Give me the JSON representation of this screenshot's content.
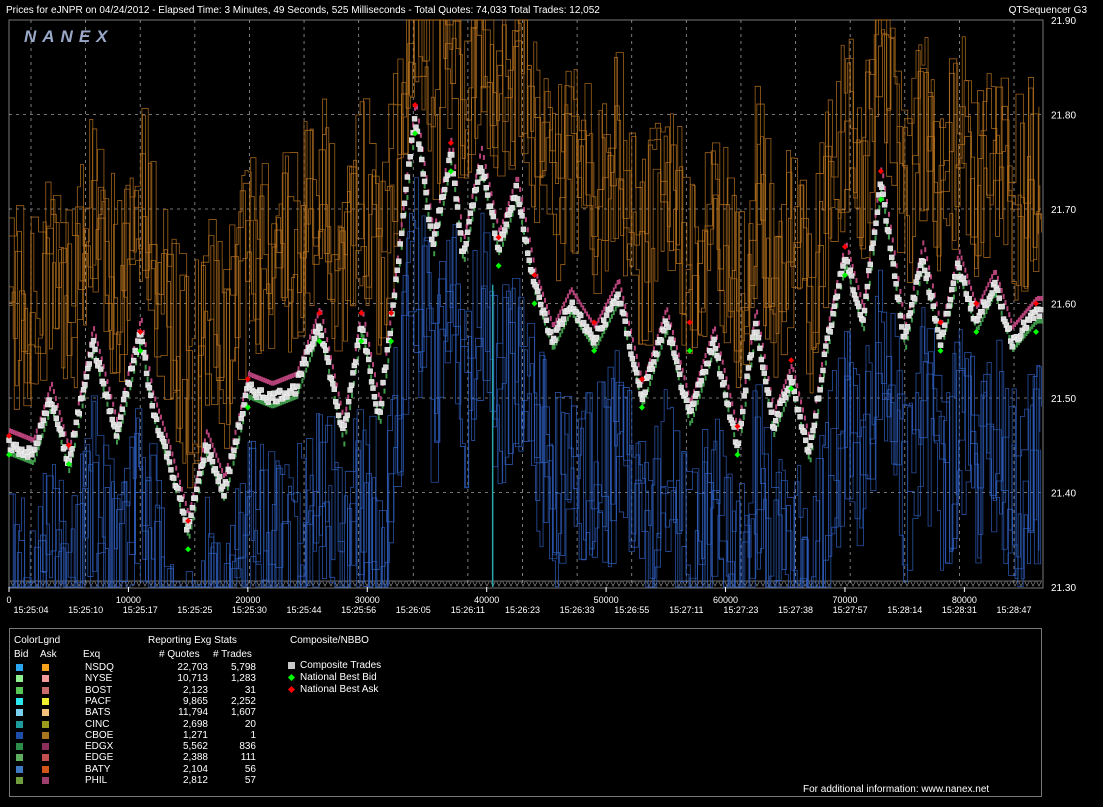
{
  "header": {
    "title": "Prices for  eJNPR  on  04/24/2012  -  Elapsed Time: 3 Minutes, 49 Seconds, 525 Milliseconds  -  Total Quotes: 74,033  Total Trades: 12,052",
    "app_name": "QTSequencer G3",
    "watermark": "NANEX"
  },
  "chart_data": {
    "type": "line",
    "title": "",
    "xlabel": "",
    "ylabel": "",
    "xlim": [
      0,
      86500
    ],
    "ylim": [
      21.3,
      21.9
    ],
    "grid": true,
    "y_ticks": [
      "21.90",
      "21.80",
      "21.70",
      "21.60",
      "21.50",
      "21.40",
      "21.30"
    ],
    "x_ticks": [
      "0",
      "10000",
      "20000",
      "30000",
      "40000",
      "50000",
      "60000",
      "70000",
      "80000"
    ],
    "time_labels": [
      "15:25:04",
      "15:25:10",
      "15:25:17",
      "15:25:25",
      "15:25:30",
      "15:25:44",
      "15:25:56",
      "15:26:05",
      "15:26:11",
      "15:26:23",
      "15:26:33",
      "15:26:55",
      "15:27:11",
      "15:27:23",
      "15:27:38",
      "15:27:57",
      "15:28:14",
      "15:28:31",
      "15:28:47"
    ],
    "series": [
      {
        "name": "Composite Trades",
        "x": [
          0,
          2000,
          3500,
          5000,
          7000,
          9000,
          11000,
          12000,
          13500,
          15000,
          16500,
          18000,
          20000,
          22000,
          24000,
          26000,
          28000,
          29500,
          31000,
          32000,
          34000,
          35500,
          37000,
          38000,
          39500,
          41000,
          42500,
          44000,
          45500,
          47000,
          49000,
          51000,
          53000,
          55000,
          57000,
          59000,
          61000,
          62500,
          64000,
          65500,
          67000,
          68500,
          70000,
          71500,
          73000,
          75000,
          76500,
          78000,
          79500,
          81000,
          82500,
          84000,
          86000
        ],
        "y": [
          21.45,
          21.44,
          21.5,
          21.43,
          21.56,
          21.46,
          21.57,
          21.49,
          21.43,
          21.36,
          21.45,
          21.4,
          21.51,
          21.5,
          21.51,
          21.58,
          21.46,
          21.58,
          21.48,
          21.58,
          21.8,
          21.66,
          21.76,
          21.65,
          21.75,
          21.66,
          21.72,
          21.62,
          21.56,
          21.6,
          21.56,
          21.61,
          21.5,
          21.58,
          21.48,
          21.56,
          21.45,
          21.58,
          21.47,
          21.52,
          21.44,
          21.56,
          21.65,
          21.58,
          21.73,
          21.56,
          21.65,
          21.56,
          21.64,
          21.58,
          21.62,
          21.56,
          21.59
        ]
      },
      {
        "name": "National Best Bid",
        "x": [
          0,
          5000,
          11000,
          15000,
          20000,
          26000,
          29500,
          32000,
          34000,
          37000,
          41000,
          44000,
          49000,
          53000,
          57000,
          61000,
          65500,
          70000,
          73000,
          78000,
          81000,
          86000
        ],
        "y": [
          21.44,
          21.43,
          21.55,
          21.34,
          21.49,
          21.56,
          21.56,
          21.56,
          21.78,
          21.74,
          21.64,
          21.6,
          21.55,
          21.49,
          21.55,
          21.44,
          21.51,
          21.63,
          21.71,
          21.55,
          21.57,
          21.57
        ]
      },
      {
        "name": "National Best Ask",
        "x": [
          0,
          5000,
          11000,
          15000,
          20000,
          26000,
          29500,
          32000,
          34000,
          37000,
          41000,
          44000,
          49000,
          53000,
          57000,
          61000,
          65500,
          70000,
          73000,
          78000,
          81000,
          86000
        ],
        "y": [
          21.46,
          21.45,
          21.57,
          21.37,
          21.52,
          21.59,
          21.59,
          21.59,
          21.81,
          21.77,
          21.67,
          21.63,
          21.58,
          21.52,
          21.58,
          21.47,
          21.54,
          21.66,
          21.74,
          21.58,
          21.6,
          21.6
        ]
      }
    ]
  },
  "legend": {
    "color_legend_label": "ColorLgnd",
    "bid_label": "Bid",
    "ask_label": "Ask",
    "exchange_header": "Exq",
    "stats_header": "Reporting Exg Stats",
    "quotes_header": "# Quotes",
    "trades_header": "# Trades",
    "composite_header": "Composite/NBBO",
    "exchanges": [
      {
        "name": "NSDQ",
        "quotes": "22,703",
        "trades": "5,798",
        "bid_color": "#2aa7f0",
        "ask_color": "#f5a31c"
      },
      {
        "name": "NYSE",
        "quotes": "10,713",
        "trades": "1,283",
        "bid_color": "#8ef08e",
        "ask_color": "#f39a9a"
      },
      {
        "name": "BOST",
        "quotes": "2,123",
        "trades": "31",
        "bid_color": "#56c756",
        "ask_color": "#c76a6a"
      },
      {
        "name": "PACF",
        "quotes": "9,865",
        "trades": "2,252",
        "bid_color": "#2ee8f0",
        "ask_color": "#f0f02e"
      },
      {
        "name": "BATS",
        "quotes": "11,794",
        "trades": "1,607",
        "bid_color": "#7ad0ef",
        "ask_color": "#f4c27a"
      },
      {
        "name": "CINC",
        "quotes": "2,698",
        "trades": "20",
        "bid_color": "#1c9c9c",
        "ask_color": "#9c9c1c"
      },
      {
        "name": "CBOE",
        "quotes": "1,271",
        "trades": "1",
        "bid_color": "#1e4fa8",
        "ask_color": "#a8741e"
      },
      {
        "name": "EDGX",
        "quotes": "5,562",
        "trades": "836",
        "bid_color": "#2e8c4a",
        "ask_color": "#8c2e5a"
      },
      {
        "name": "EDGE",
        "quotes": "2,388",
        "trades": "111",
        "bid_color": "#5fae5f",
        "ask_color": "#c25050"
      },
      {
        "name": "BATY",
        "quotes": "2,104",
        "trades": "56",
        "bid_color": "#3f7ac2",
        "ask_color": "#d2561a"
      },
      {
        "name": "PHIL",
        "quotes": "2,812",
        "trades": "57",
        "bid_color": "#6e9e3e",
        "ask_color": "#9e3e6e"
      }
    ],
    "composite_items": [
      {
        "label": "Composite Trades",
        "color": "#c8c8c8",
        "icon": "square-icon"
      },
      {
        "label": "National Best Bid",
        "color": "#00ff00",
        "icon": "diamond-icon"
      },
      {
        "label": "National Best Ask",
        "color": "#ff0000",
        "icon": "diamond-icon"
      }
    ]
  },
  "footer": {
    "note": "For additional information: www.nanex.net"
  },
  "colors": {
    "background": "#000000",
    "grid": "#9a9a9a",
    "ask_lines": "#b8731f",
    "bid_lines": "#2f5fbf",
    "panel_border": "#777777"
  }
}
